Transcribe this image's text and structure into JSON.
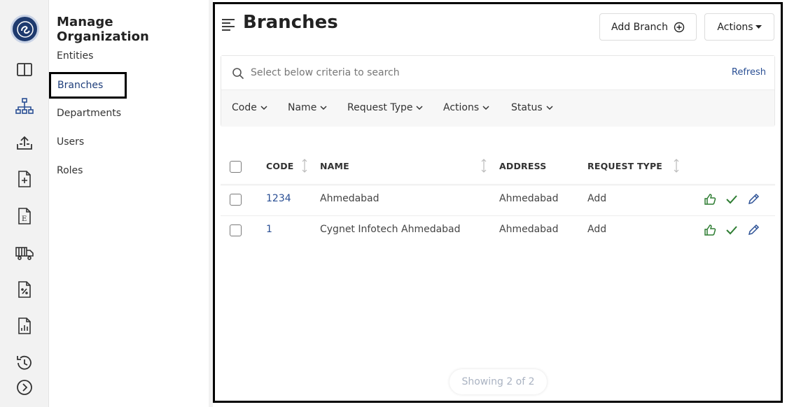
{
  "sidebar": {
    "title": "Manage Organization",
    "items": [
      {
        "label": "Entities"
      },
      {
        "label": "Branches"
      },
      {
        "label": "Departments"
      },
      {
        "label": "Users"
      },
      {
        "label": "Roles"
      }
    ],
    "active_item": "Branches"
  },
  "rail": {
    "icons": [
      "logo-icon",
      "columns-icon",
      "org-tree-icon",
      "upload-icon",
      "file-add-icon",
      "file-e-icon",
      "truck-icon",
      "file-percent-icon",
      "file-chart-icon",
      "history-icon",
      "chevron-right-circle-icon"
    ]
  },
  "header": {
    "title": "Branches",
    "add_button": "Add Branch",
    "actions_button": "Actions"
  },
  "search": {
    "placeholder": "Select below criteria to search",
    "refresh_label": "Refresh"
  },
  "criteria": [
    "Code",
    "Name",
    "Request Type",
    "Actions",
    "Status"
  ],
  "table": {
    "columns": [
      "CODE",
      "NAME",
      "ADDRESS",
      "REQUEST TYPE"
    ],
    "rows": [
      {
        "code": "1234",
        "name": "Ahmedabad",
        "address": "Ahmedabad",
        "request_type": "Add"
      },
      {
        "code": "1",
        "name": "Cygnet Infotech Ahmedabad",
        "address": "Ahmedabad",
        "request_type": "Add"
      }
    ]
  },
  "footer": {
    "showing": "Showing 2 of 2"
  },
  "colors": {
    "brand": "#1e3a6e",
    "link": "#2a4f94",
    "approve": "#2e7d32",
    "rail_bg": "#f2f2f2"
  }
}
